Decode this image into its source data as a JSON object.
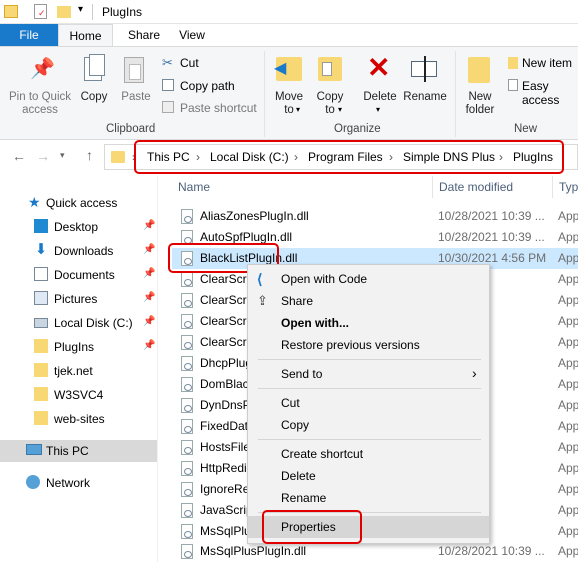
{
  "window": {
    "title": "PlugIns"
  },
  "tabs": [
    {
      "label": "File"
    },
    {
      "label": "Home"
    },
    {
      "label": "Share"
    },
    {
      "label": "View"
    }
  ],
  "ribbon": {
    "pin": "Pin to Quick access",
    "copy": "Copy",
    "paste": "Paste",
    "cut": "Cut",
    "copy_path": "Copy path",
    "paste_shortcut": "Paste shortcut",
    "clipboard_group": "Clipboard",
    "move_to": "Move to",
    "copy_to": "Copy to",
    "delete": "Delete",
    "rename": "Rename",
    "organize_group": "Organize",
    "new_folder": "New folder",
    "new_item": "New item",
    "easy_access": "Easy access",
    "new_group": "New"
  },
  "address": {
    "crumbs": [
      "This PC",
      "Local Disk (C:)",
      "Program Files",
      "Simple DNS Plus",
      "PlugIns"
    ]
  },
  "nav": {
    "items": [
      {
        "label": "Quick access"
      },
      {
        "label": "Desktop"
      },
      {
        "label": "Downloads"
      },
      {
        "label": "Documents"
      },
      {
        "label": "Pictures"
      },
      {
        "label": "Local Disk (C:)"
      },
      {
        "label": "PlugIns"
      },
      {
        "label": "tjek.net"
      },
      {
        "label": "W3SVC4"
      },
      {
        "label": "web-sites"
      },
      {
        "label": "This PC"
      },
      {
        "label": "Network"
      }
    ]
  },
  "columns": {
    "name": "Name",
    "date": "Date modified",
    "type": "Typ"
  },
  "files": [
    {
      "name": "AliasZonesPlugIn.dll",
      "date": "10/28/2021 10:39 ...",
      "type": "App"
    },
    {
      "name": "AutoSpfPlugIn.dll",
      "date": "10/28/2021 10:39 ...",
      "type": "App"
    },
    {
      "name": "BlackListPlugIn.dll",
      "date": "10/30/2021 4:56 PM",
      "type": "App"
    },
    {
      "name": "ClearScri",
      "date": "",
      "type": "App"
    },
    {
      "name": "ClearScri",
      "date": "",
      "type": "App"
    },
    {
      "name": "ClearScri",
      "date": "",
      "type": "App"
    },
    {
      "name": "ClearScri",
      "date": "",
      "type": "App"
    },
    {
      "name": "DhcpPlug",
      "date": "",
      "type": "App"
    },
    {
      "name": "DomBlac",
      "date": "",
      "type": "App"
    },
    {
      "name": "DynDnsP",
      "date": "",
      "type": "App"
    },
    {
      "name": "FixedData",
      "date": "",
      "type": "App"
    },
    {
      "name": "HostsFile",
      "date": "",
      "type": "App"
    },
    {
      "name": "HttpRedi",
      "date": "",
      "type": "App"
    },
    {
      "name": "IgnoreRe",
      "date": "",
      "type": "App"
    },
    {
      "name": "JavaScrip",
      "date": "",
      "type": "App"
    },
    {
      "name": "MsSqlPlu",
      "date": "",
      "type": "App"
    },
    {
      "name": "MsSqlPlusPlugIn.dll",
      "date": "10/28/2021 10:39 ...",
      "type": "App"
    }
  ],
  "context_menu": {
    "open_with_code": "Open with Code",
    "share": "Share",
    "open_with": "Open with...",
    "restore": "Restore previous versions",
    "send_to": "Send to",
    "cut": "Cut",
    "copy": "Copy",
    "create_shortcut": "Create shortcut",
    "delete": "Delete",
    "rename": "Rename",
    "properties": "Properties"
  },
  "colors": {
    "accent": "#1979ca",
    "highlight_red": "#e00000",
    "selection": "#cce8ff"
  }
}
